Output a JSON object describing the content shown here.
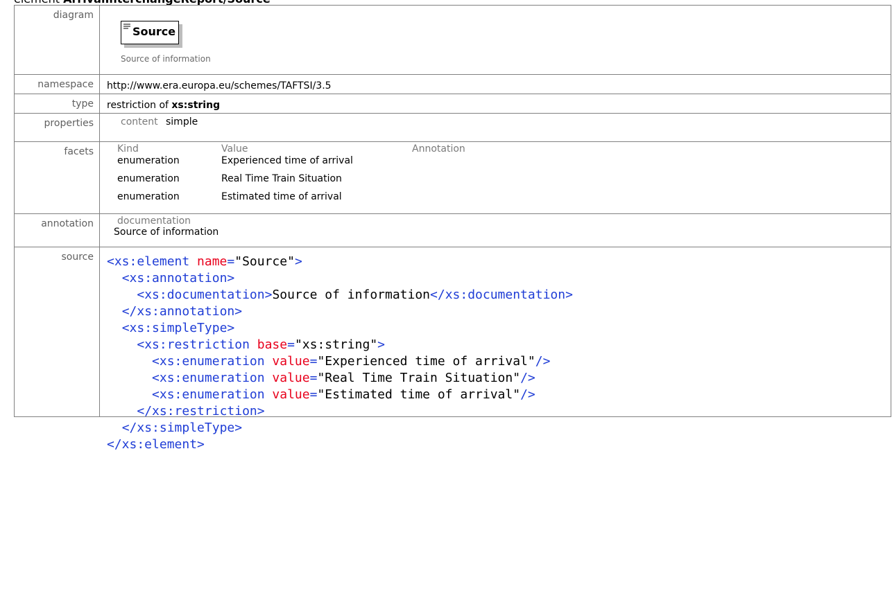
{
  "header": {
    "prefix": "element",
    "name": "ArrivalInterchangeReport/Source"
  },
  "rows": {
    "diagram": {
      "label": "diagram",
      "box_title": "Source",
      "caption": "Source of information"
    },
    "namespace": {
      "label": "namespace",
      "value": "http://www.era.europa.eu/schemes/TAFTSI/3.5"
    },
    "type": {
      "label": "type",
      "prefix": "restriction of",
      "base": "xs:string"
    },
    "properties": {
      "label": "properties",
      "key": "content",
      "value": "simple"
    },
    "facets": {
      "label": "facets",
      "headers": {
        "kind": "Kind",
        "value": "Value",
        "annotation": "Annotation"
      },
      "items": [
        {
          "kind": "enumeration",
          "value": "Experienced time of arrival",
          "annotation": ""
        },
        {
          "kind": "enumeration",
          "value": "Real Time Train Situation",
          "annotation": ""
        },
        {
          "kind": "enumeration",
          "value": "Estimated time of arrival",
          "annotation": ""
        }
      ]
    },
    "annotation": {
      "label": "annotation",
      "key": "documentation",
      "value": "Source of information"
    },
    "source": {
      "label": "source",
      "lines": [
        {
          "indent": "",
          "parts": [
            [
              "tag",
              "<xs:element "
            ],
            [
              "attr",
              "name"
            ],
            [
              "tag",
              "="
            ],
            [
              "txt",
              "\"Source\""
            ],
            [
              "tag",
              ">"
            ]
          ]
        },
        {
          "indent": "  ",
          "parts": [
            [
              "tag",
              "<xs:annotation>"
            ]
          ]
        },
        {
          "indent": "    ",
          "parts": [
            [
              "tag",
              "<xs:documentation>"
            ],
            [
              "txt",
              "Source of information"
            ],
            [
              "tag",
              "</xs:documentation>"
            ]
          ]
        },
        {
          "indent": "  ",
          "parts": [
            [
              "tag",
              "</xs:annotation>"
            ]
          ]
        },
        {
          "indent": "  ",
          "parts": [
            [
              "tag",
              "<xs:simpleType>"
            ]
          ]
        },
        {
          "indent": "    ",
          "parts": [
            [
              "tag",
              "<xs:restriction "
            ],
            [
              "attr",
              "base"
            ],
            [
              "tag",
              "="
            ],
            [
              "txt",
              "\"xs:string\""
            ],
            [
              "tag",
              ">"
            ]
          ]
        },
        {
          "indent": "      ",
          "parts": [
            [
              "tag",
              "<xs:enumeration "
            ],
            [
              "attr",
              "value"
            ],
            [
              "tag",
              "="
            ],
            [
              "txt",
              "\"Experienced time of arrival\""
            ],
            [
              "tag",
              "/>"
            ]
          ]
        },
        {
          "indent": "      ",
          "parts": [
            [
              "tag",
              "<xs:enumeration "
            ],
            [
              "attr",
              "value"
            ],
            [
              "tag",
              "="
            ],
            [
              "txt",
              "\"Real Time Train Situation\""
            ],
            [
              "tag",
              "/>"
            ]
          ]
        },
        {
          "indent": "      ",
          "parts": [
            [
              "tag",
              "<xs:enumeration "
            ],
            [
              "attr",
              "value"
            ],
            [
              "tag",
              "="
            ],
            [
              "txt",
              "\"Estimated time of arrival\""
            ],
            [
              "tag",
              "/>"
            ]
          ]
        },
        {
          "indent": "    ",
          "parts": [
            [
              "tag",
              "</xs:restriction>"
            ]
          ]
        },
        {
          "indent": "  ",
          "parts": [
            [
              "tag",
              "</xs:simpleType>"
            ]
          ]
        },
        {
          "indent": "",
          "parts": [
            [
              "tag",
              "</xs:element>"
            ]
          ]
        }
      ]
    }
  }
}
